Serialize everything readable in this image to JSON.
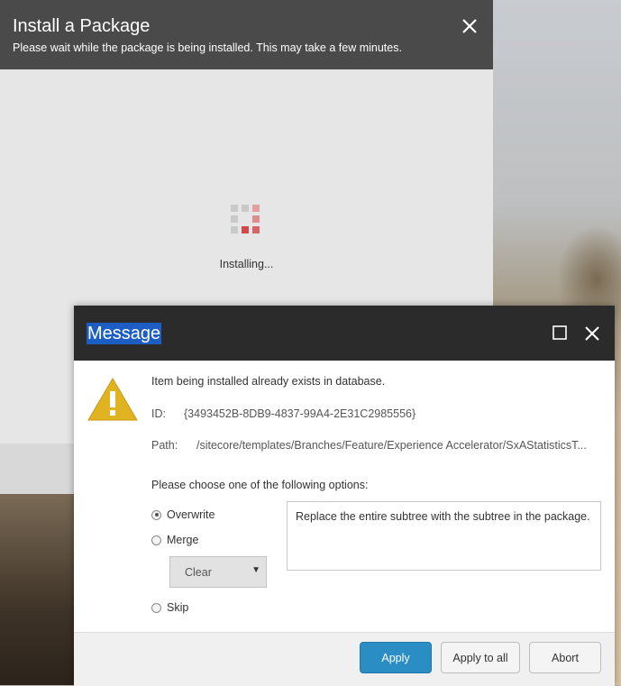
{
  "install": {
    "title": "Install a Package",
    "subtitle": "Please wait while the package is being installed. This may take a few minutes.",
    "status": "Installing..."
  },
  "message": {
    "title": "Message",
    "headline": "Item being installed already exists in database.",
    "id_label": "ID:",
    "id_value": "{3493452B-8DB9-4837-99A4-2E31C2985556}",
    "path_label": "Path:",
    "path_value": "/sitecore/templates/Branches/Feature/Experience Accelerator/SxAStatisticsT...",
    "choose_prompt": "Please choose one of the following options:",
    "options": [
      {
        "label": "Overwrite",
        "selected": true
      },
      {
        "label": "Merge",
        "selected": false
      },
      {
        "label": "Skip",
        "selected": false
      }
    ],
    "merge_select_value": "Clear",
    "description": "Replace the entire subtree with the subtree in the package.",
    "buttons": {
      "apply": "Apply",
      "apply_all": "Apply to all",
      "abort": "Abort"
    }
  },
  "colors": {
    "primary_button": "#2a8ec4",
    "warning": "#e0b420",
    "title_highlight": "#1c5ec4",
    "spinner_active": "#d04848"
  },
  "icons": [
    "close-icon",
    "maximize-icon",
    "warning-icon",
    "loading-spinner-icon",
    "dropdown-arrow-icon"
  ]
}
